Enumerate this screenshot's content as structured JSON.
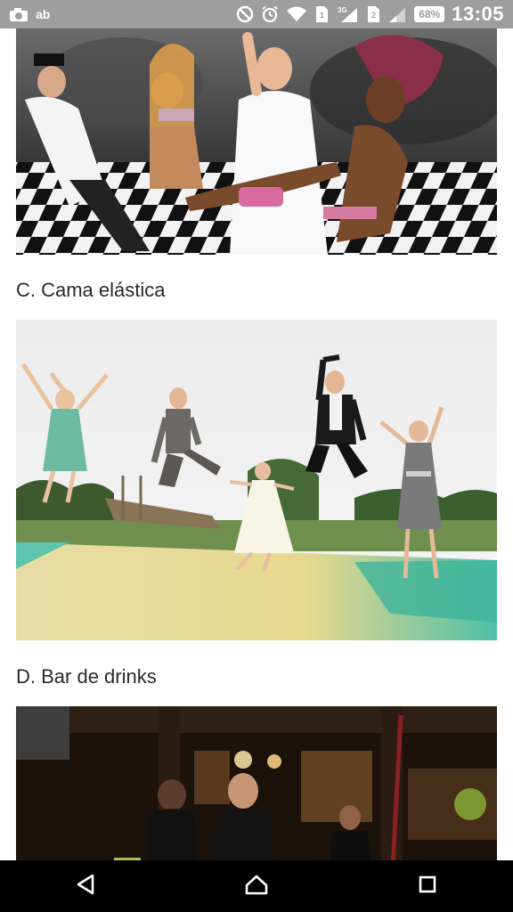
{
  "status_bar": {
    "left_icons": [
      "camera-icon",
      "ab-app-icon"
    ],
    "left_text": "ab",
    "right_icons": [
      "no-disturb-icon",
      "alarm-icon",
      "wifi-icon",
      "sim1-signal-icon",
      "sim2-signal-icon"
    ],
    "network_sup": "3G",
    "sim2_label": "2",
    "battery": "68%",
    "time": "13:05"
  },
  "content": {
    "photos": [
      {
        "subject": "party-dance-photo"
      },
      {
        "subject": "trampoline-jump-photo"
      },
      {
        "subject": "bar-drinks-photo"
      }
    ],
    "captions": {
      "c": "C. Cama elástica",
      "d": "D. Bar de drinks"
    }
  },
  "nav_bar": {
    "buttons": [
      "back-icon",
      "home-icon",
      "recents-icon"
    ]
  },
  "colors": {
    "status_bar_bg": "#9e9e9e",
    "nav_bar_bg": "#000000",
    "text": "#2a2a2a"
  }
}
